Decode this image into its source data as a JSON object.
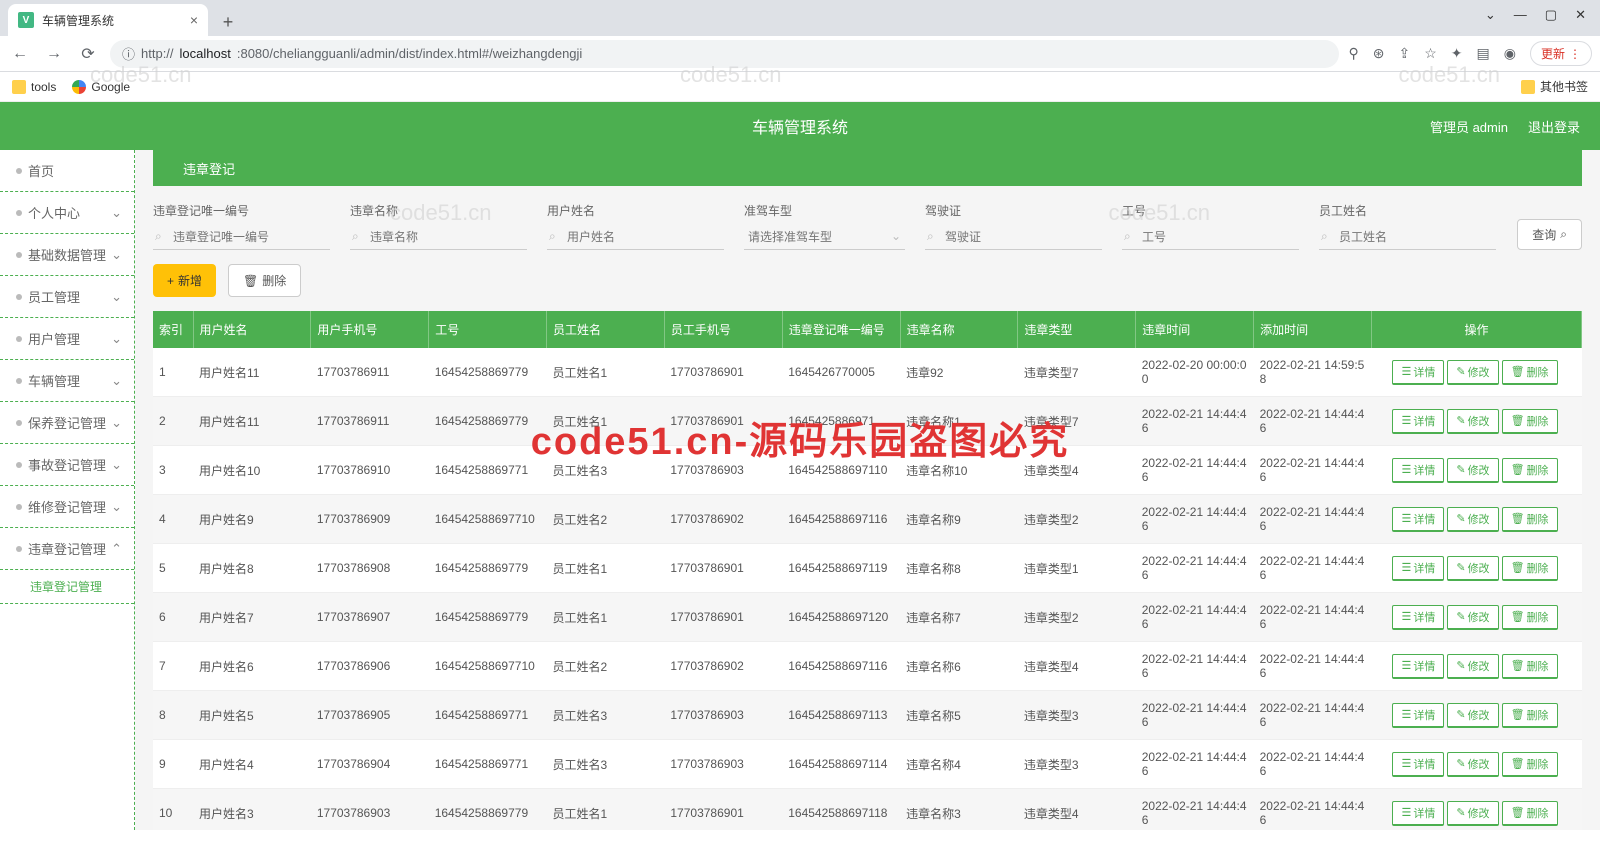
{
  "browser": {
    "tab_title": "车辆管理系统",
    "url_prefix": "http://",
    "url_host": "localhost",
    "url_path": ":8080/cheliangguanli/admin/dist/index.html#/weizhangdengji",
    "update_label": "更新",
    "bookmarks": {
      "tools": "tools",
      "google": "Google",
      "other": "其他书签"
    }
  },
  "header": {
    "title": "车辆管理系统",
    "user_label": "管理员 admin",
    "logout": "退出登录"
  },
  "sidebar": {
    "items": [
      {
        "label": "首页",
        "sub": false
      },
      {
        "label": "个人中心",
        "sub": true
      },
      {
        "label": "基础数据管理",
        "sub": true
      },
      {
        "label": "员工管理",
        "sub": true
      },
      {
        "label": "用户管理",
        "sub": true
      },
      {
        "label": "车辆管理",
        "sub": true
      },
      {
        "label": "保养登记管理",
        "sub": true
      },
      {
        "label": "事故登记管理",
        "sub": true
      },
      {
        "label": "维修登记管理",
        "sub": true
      },
      {
        "label": "违章登记管理",
        "sub": true,
        "expanded": true,
        "child": "违章登记管理"
      }
    ]
  },
  "breadcrumb": "违章登记",
  "filters": {
    "f1": {
      "label": "违章登记唯一编号",
      "ph": "违章登记唯一编号"
    },
    "f2": {
      "label": "违章名称",
      "ph": "违章名称"
    },
    "f3": {
      "label": "用户姓名",
      "ph": "用户姓名"
    },
    "f4": {
      "label": "准驾车型",
      "ph": "请选择准驾车型"
    },
    "f5": {
      "label": "驾驶证",
      "ph": "驾驶证"
    },
    "f6": {
      "label": "工号",
      "ph": "工号"
    },
    "f7": {
      "label": "员工姓名",
      "ph": "员工姓名"
    },
    "query": "查询"
  },
  "actions": {
    "add": "新增",
    "delete": "删除"
  },
  "table": {
    "headers": [
      "索引",
      "用户姓名",
      "用户手机号",
      "工号",
      "员工姓名",
      "员工手机号",
      "违章登记唯一编号",
      "违章名称",
      "违章类型",
      "违章时间",
      "添加时间",
      "操作"
    ],
    "op_labels": {
      "detail": "详情",
      "edit": "修改",
      "del": "删除"
    },
    "rows": [
      {
        "idx": "1",
        "user": "用户姓名11",
        "uphone": "17703786911",
        "eno": "16454258869779",
        "ename": "员工姓名1",
        "ephone": "17703786901",
        "uniq": "1645426770005",
        "vname": "违章92",
        "vtype": "违章类型7",
        "vtime": "2022-02-20 00:00:00",
        "atime": "2022-02-21 14:59:58"
      },
      {
        "idx": "2",
        "user": "用户姓名11",
        "uphone": "17703786911",
        "eno": "16454258869779",
        "ename": "员工姓名1",
        "ephone": "17703786901",
        "uniq": "1645425886971",
        "vname": "违章名称1",
        "vtype": "违章类型7",
        "vtime": "2022-02-21 14:44:46",
        "atime": "2022-02-21 14:44:46"
      },
      {
        "idx": "3",
        "user": "用户姓名10",
        "uphone": "17703786910",
        "eno": "16454258869771",
        "ename": "员工姓名3",
        "ephone": "17703786903",
        "uniq": "164542588697110",
        "vname": "违章名称10",
        "vtype": "违章类型4",
        "vtime": "2022-02-21 14:44:46",
        "atime": "2022-02-21 14:44:46"
      },
      {
        "idx": "4",
        "user": "用户姓名9",
        "uphone": "17703786909",
        "eno": "164542588697710",
        "ename": "员工姓名2",
        "ephone": "17703786902",
        "uniq": "164542588697116",
        "vname": "违章名称9",
        "vtype": "违章类型2",
        "vtime": "2022-02-21 14:44:46",
        "atime": "2022-02-21 14:44:46"
      },
      {
        "idx": "5",
        "user": "用户姓名8",
        "uphone": "17703786908",
        "eno": "16454258869779",
        "ename": "员工姓名1",
        "ephone": "17703786901",
        "uniq": "164542588697119",
        "vname": "违章名称8",
        "vtype": "违章类型1",
        "vtime": "2022-02-21 14:44:46",
        "atime": "2022-02-21 14:44:46"
      },
      {
        "idx": "6",
        "user": "用户姓名7",
        "uphone": "17703786907",
        "eno": "16454258869779",
        "ename": "员工姓名1",
        "ephone": "17703786901",
        "uniq": "164542588697120",
        "vname": "违章名称7",
        "vtype": "违章类型2",
        "vtime": "2022-02-21 14:44:46",
        "atime": "2022-02-21 14:44:46"
      },
      {
        "idx": "7",
        "user": "用户姓名6",
        "uphone": "17703786906",
        "eno": "164542588697710",
        "ename": "员工姓名2",
        "ephone": "17703786902",
        "uniq": "164542588697116",
        "vname": "违章名称6",
        "vtype": "违章类型4",
        "vtime": "2022-02-21 14:44:46",
        "atime": "2022-02-21 14:44:46"
      },
      {
        "idx": "8",
        "user": "用户姓名5",
        "uphone": "17703786905",
        "eno": "16454258869771",
        "ename": "员工姓名3",
        "ephone": "17703786903",
        "uniq": "164542588697113",
        "vname": "违章名称5",
        "vtype": "违章类型3",
        "vtime": "2022-02-21 14:44:46",
        "atime": "2022-02-21 14:44:46"
      },
      {
        "idx": "9",
        "user": "用户姓名4",
        "uphone": "17703786904",
        "eno": "16454258869771",
        "ename": "员工姓名3",
        "ephone": "17703786903",
        "uniq": "164542588697114",
        "vname": "违章名称4",
        "vtype": "违章类型3",
        "vtime": "2022-02-21 14:44:46",
        "atime": "2022-02-21 14:44:46"
      },
      {
        "idx": "10",
        "user": "用户姓名3",
        "uphone": "17703786903",
        "eno": "16454258869779",
        "ename": "员工姓名1",
        "ephone": "17703786901",
        "uniq": "164542588697118",
        "vname": "违章名称3",
        "vtype": "违章类型4",
        "vtime": "2022-02-21 14:44:46",
        "atime": "2022-02-21 14:44:46"
      }
    ]
  },
  "watermark": "code51.cn",
  "big_watermark": "code51.cn-源码乐园盗图必究"
}
